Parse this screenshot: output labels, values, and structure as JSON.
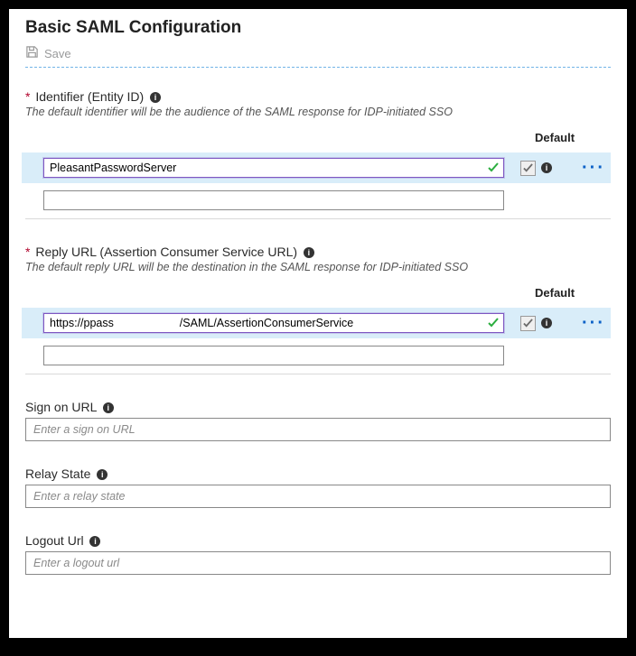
{
  "heading": "Basic SAML Configuration",
  "save_label": "Save",
  "default_header": "Default",
  "identifier": {
    "label": "Identifier (Entity ID)",
    "desc": "The default identifier will be the audience of the SAML response for IDP-initiated SSO",
    "rows": [
      {
        "value": "PleasantPasswordServer",
        "valid": true,
        "default_checked": true
      },
      {
        "value": "",
        "valid": false,
        "default_checked": false
      }
    ]
  },
  "reply_url": {
    "label": "Reply URL (Assertion Consumer Service URL)",
    "desc": "The default reply URL will be the destination in the SAML response for IDP-initiated SSO",
    "rows": [
      {
        "value": "https://ppass                     /SAML/AssertionConsumerService",
        "valid": true,
        "default_checked": true
      },
      {
        "value": "",
        "valid": false,
        "default_checked": false
      }
    ]
  },
  "sign_on": {
    "label": "Sign on URL",
    "placeholder": "Enter a sign on URL",
    "value": ""
  },
  "relay_state": {
    "label": "Relay State",
    "placeholder": "Enter a relay state",
    "value": ""
  },
  "logout": {
    "label": "Logout Url",
    "placeholder": "Enter a logout url",
    "value": ""
  }
}
